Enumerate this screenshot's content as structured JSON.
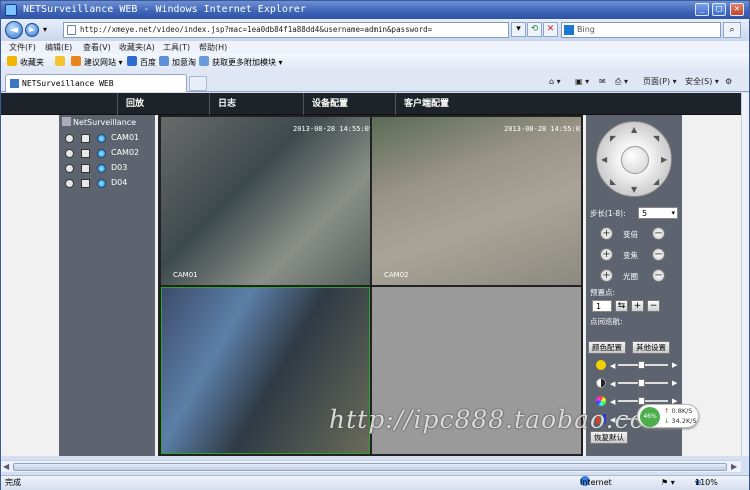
{
  "window": {
    "title": "NETSurveillance WEB - Windows Internet Explorer",
    "min": "_",
    "max": "□",
    "close": "✕"
  },
  "addressbar": {
    "url": "http://xmeye.net/video/index.jsp?mac=1ea0db84f1a88dd4&username=admin&password=",
    "search_placeholder": "Bing",
    "back": "◄",
    "forward": "►"
  },
  "menubar": [
    "文件(F)",
    "编辑(E)",
    "查看(V)",
    "收藏夹(A)",
    "工具(T)",
    "帮助(H)"
  ],
  "favorites_bar": {
    "favorites": "收藏夹",
    "items": [
      "建议网站 ▾",
      "百度",
      "加意淘",
      "获取更多附加模块 ▾"
    ]
  },
  "tabs": [
    {
      "label": "NETSurveillance WEB"
    }
  ],
  "command_bar": {
    "page": "页面(P) ▾",
    "safety": "安全(S) ▾"
  },
  "app": {
    "header_tabs": [
      "回放",
      "日志",
      "设备配置",
      "客户端配置"
    ],
    "sidebar": {
      "root": "NetSurveillance",
      "channels": [
        {
          "label": "CAM01"
        },
        {
          "label": "CAM02"
        },
        {
          "label": "D03"
        },
        {
          "label": "D04"
        }
      ]
    },
    "video": {
      "cells": [
        {
          "timestamp": "2013-08-28 14:55:05",
          "name": "CAM01"
        },
        {
          "timestamp": "2013-08-28 14:55:03",
          "name": "CAM02"
        },
        {
          "timestamp": "",
          "name": ""
        },
        {
          "timestamp": "",
          "name": ""
        }
      ]
    },
    "ptz": {
      "step_label": "步长(1-8):",
      "step_value": "5",
      "zoom": "变倍",
      "focus": "变焦",
      "iris": "光圈",
      "preset_label": "预置点:",
      "preset_value": "1",
      "cruise_label": "点间巡航:",
      "color_config": "颜色配置",
      "other_settings": "其他设置",
      "restore_default": "恢复默认",
      "plus": "+",
      "minus": "−"
    },
    "network_widget": {
      "percent": "46%",
      "up": "0.8K/S",
      "down": "34.2K/S"
    }
  },
  "status_bar": {
    "left": "完成",
    "zone": "Internet",
    "zoom": "110%"
  },
  "watermark": "http://ipc888.taobao.com"
}
